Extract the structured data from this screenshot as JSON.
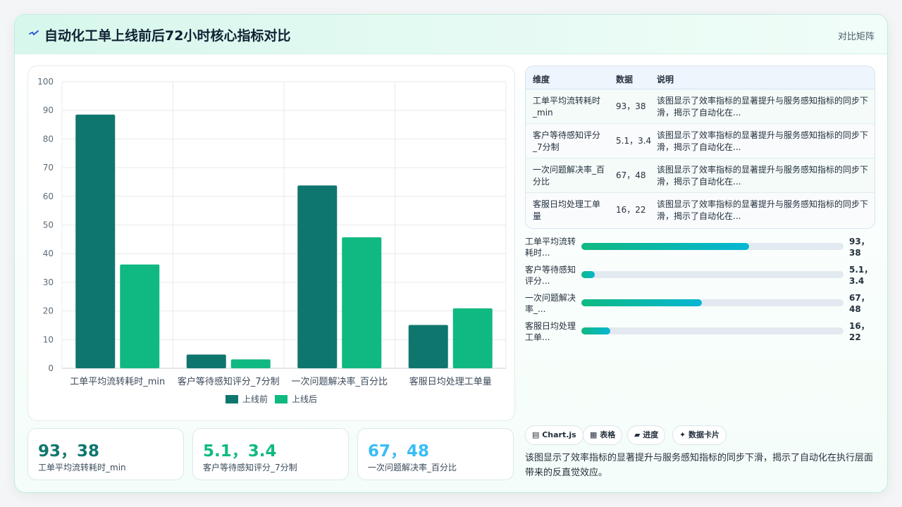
{
  "header": {
    "title": "自动化工单上线前后72小时核心指标对比",
    "tag": "对比矩阵"
  },
  "chart_data": {
    "type": "bar",
    "categories": [
      "工单平均流转耗时_min",
      "客户等待感知评分_7分制",
      "一次问题解决率_百分比",
      "客服日均处理工单量"
    ],
    "series": [
      {
        "name": "上线前",
        "values": [
          88.5,
          4.8,
          63.8,
          15.1
        ],
        "color": "#0f766e"
      },
      {
        "name": "上线后",
        "values": [
          36.2,
          3.1,
          45.7,
          20.9
        ],
        "color": "#10b981"
      }
    ],
    "ylim": [
      0,
      100
    ],
    "yticks": [
      0,
      10,
      20,
      30,
      40,
      50,
      60,
      70,
      80,
      90,
      100
    ],
    "grid": true,
    "legend": "bottom"
  },
  "table": {
    "headers": [
      "维度",
      "数据",
      "说明"
    ],
    "rows": [
      {
        "name": "工单平均流转耗时_min",
        "value": "93，38",
        "desc": "该图显示了效率指标的显著提升与服务感知指标的同步下滑，揭示了自动化在..."
      },
      {
        "name": "客户等待感知评分_7分制",
        "value": "5.1，3.4",
        "desc": "该图显示了效率指标的显著提升与服务感知指标的同步下滑，揭示了自动化在..."
      },
      {
        "name": "一次问题解决率_百分比",
        "value": "67，48",
        "desc": "该图显示了效率指标的显著提升与服务感知指标的同步下滑，揭示了自动化在..."
      },
      {
        "name": "客服日均处理工单量",
        "value": "16，22",
        "desc": "该图显示了效率指标的显著提升与服务感知指标的同步下滑，揭示了自动化在..."
      }
    ]
  },
  "progress": [
    {
      "label": "工单平均流转耗时...",
      "value": "93，38",
      "fraction": 0.64
    },
    {
      "label": "客户等待感知评分...",
      "value": "5.1，3.4",
      "fraction": 0.05
    },
    {
      "label": "一次问题解决率_...",
      "value": "67，48",
      "fraction": 0.46
    },
    {
      "label": "客服日均处理工单...",
      "value": "16，22",
      "fraction": 0.11
    }
  ],
  "kpis": [
    {
      "value": "93，38",
      "label": "工单平均流转耗时_min",
      "color": "#0f766e"
    },
    {
      "value": "5.1，3.4",
      "label": "客户等待感知评分_7分制",
      "color": "#10b981"
    },
    {
      "value": "67，48",
      "label": "一次问题解决率_百分比",
      "color": "#38bdf8"
    }
  ],
  "chips": [
    "▤ Chart.js",
    "▦ 表格",
    "▰ 进度",
    "✦ 数据卡片"
  ],
  "summary": "该图显示了效率指标的显著提升与服务感知指标的同步下滑，揭示了自动化在执行层面带来的反直觉效应。"
}
